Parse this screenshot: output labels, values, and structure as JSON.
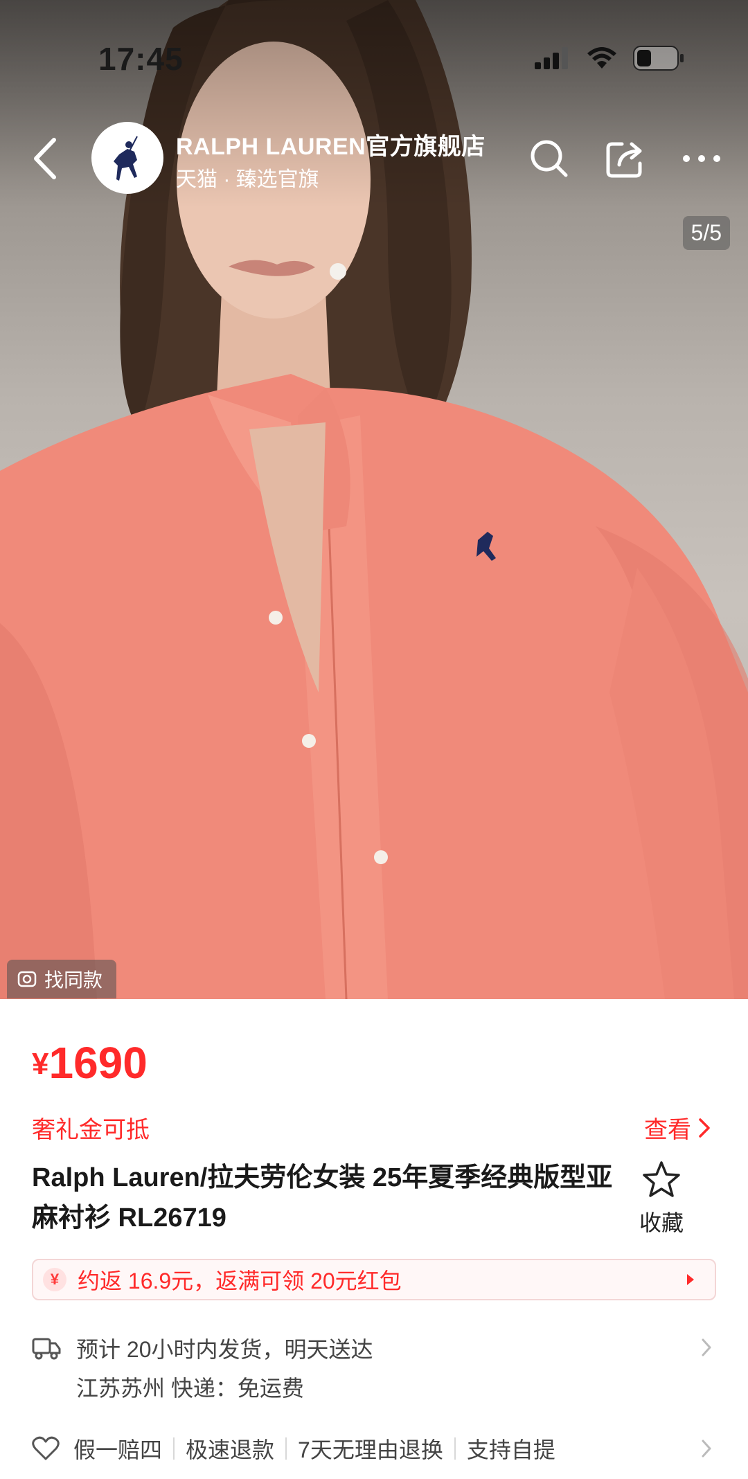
{
  "status_bar": {
    "time": "17:45"
  },
  "nav": {
    "shop_name": "RALPH LAUREN官方旗舰店",
    "shop_sub": "天猫 · 臻选官旗",
    "icons": [
      "back-icon",
      "search-icon",
      "share-icon",
      "more-icon"
    ]
  },
  "gallery": {
    "counter": "5/5",
    "find_same": "找同款"
  },
  "product": {
    "currency": "¥",
    "price": "1690",
    "coupon_label": "奢礼金可抵",
    "coupon_view": "查看",
    "title": "Ralph Lauren/拉夫劳伦女装 25年夏季经典版型亚麻衬衫 RL26719",
    "favorite_label": "收藏"
  },
  "cashback": {
    "icon_text": "¥",
    "text": "约返 16.9元，返满可领 20元红包"
  },
  "shipping": {
    "line1": "预计 20小时内发货，明天送达",
    "line2": "江苏苏州  快递：免运费"
  },
  "guarantees": [
    "假一赔四",
    "极速退款",
    "7天无理由退换",
    "支持自提"
  ],
  "colors": {
    "accent": "#ff2a2a",
    "shirt": "#f08a7a"
  }
}
